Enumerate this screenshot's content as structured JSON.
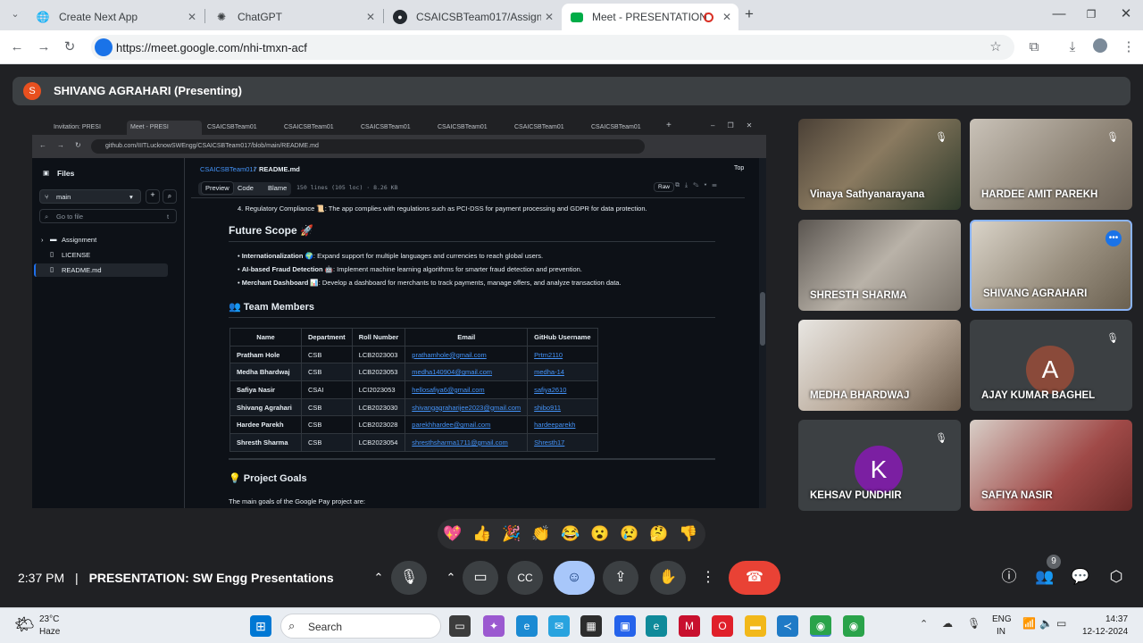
{
  "browser": {
    "tabs": [
      {
        "title": "Create Next App",
        "icon": "globe-icon"
      },
      {
        "title": "ChatGPT",
        "icon": "chatgpt-icon"
      },
      {
        "title": "CSAICSBTeam017/Assignment/",
        "icon": "github-icon"
      },
      {
        "title": "Meet - PRESENTATION: SW",
        "icon": "meet-icon",
        "active": true
      }
    ],
    "url": "https://meet.google.com/nhi-tmxn-acf"
  },
  "meet": {
    "presenter_initial": "S",
    "presenter": "SHIVANG AGRAHARI (Presenting)",
    "time": "2:37 PM",
    "separator": "|",
    "meeting_title": "PRESENTATION: SW Engg Presentations",
    "participant_count": "9",
    "participants": [
      {
        "name": "Vinaya Sathyanarayana",
        "muted": true
      },
      {
        "name": "HARDEE AMIT PAREKH",
        "muted": true
      },
      {
        "name": "SHRESTH SHARMA",
        "muted": false
      },
      {
        "name": "SHIVANG AGRAHARI",
        "muted": false,
        "speaking": true
      },
      {
        "name": "MEDHA BHARDWAJ",
        "muted": false
      },
      {
        "name": "AJAY KUMAR BAGHEL",
        "initial": "A",
        "muted": true
      },
      {
        "name": "KEHSAV PUNDHIR",
        "initial": "K",
        "muted": true
      },
      {
        "name": "SAFIYA NASIR",
        "muted": false
      }
    ],
    "reactions": [
      "💖",
      "👍",
      "🎉",
      "👏",
      "😂",
      "😮",
      "😢",
      "🤔",
      "👎"
    ]
  },
  "shared_screen": {
    "tabs": [
      "Invitation: PRESI",
      "Meet - PRESI",
      "CSAICSBTeam01",
      "CSAICSBTeam01",
      "CSAICSBTeam01",
      "CSAICSBTeam01",
      "CSAICSBTeam01",
      "CSAICSBTeam01"
    ],
    "url": "github.com/IIITLucknowSWEngg/CSAICSBTeam017/blob/main/README.md",
    "sidebar": {
      "title": "Files",
      "branch": "main",
      "search_placeholder": "Go to file",
      "search_shortcut": "t",
      "items": [
        "Assignment",
        "LICENSE",
        "README.md"
      ]
    },
    "breadcrumb_repo": "CSAICSBTeam017",
    "breadcrumb_sep": "/",
    "breadcrumb_file": "README.md",
    "top_link": "Top",
    "view_tabs": [
      "Preview",
      "Code",
      "Blame"
    ],
    "file_meta": "150 lines (105 loc) · 8.26 KB",
    "raw_label": "Raw",
    "compliance_line": "4. Regulatory Compliance 📜: The app complies with regulations such as PCI-DSS for payment processing and GDPR for data protection.",
    "future_scope_heading": "Future Scope 🚀",
    "future_items": [
      {
        "bold": "Internationalization 🌍",
        "text": ": Expand support for multiple languages and currencies to reach global users."
      },
      {
        "bold": "AI-based Fraud Detection 🤖",
        "text": ": Implement machine learning algorithms for smarter fraud detection and prevention."
      },
      {
        "bold": "Merchant Dashboard 📊",
        "text": ": Develop a dashboard for merchants to track payments, manage offers, and analyze transaction data."
      }
    ],
    "team_heading": "👥 Team Members",
    "team_columns": [
      "Name",
      "Department",
      "Roll Number",
      "Email",
      "GitHub Username"
    ],
    "team_rows": [
      [
        "Pratham Hole",
        "CSB",
        "LCB2023003",
        "prathamhole@gmail.com",
        "Prtm2110"
      ],
      [
        "Medha Bhardwaj",
        "CSB",
        "LCB2023053",
        "medha140904@gmail.com",
        "medha-14"
      ],
      [
        "Safiya Nasir",
        "CSAI",
        "LCI2023053",
        "hellosafiya6@gmail.com",
        "safiya2610"
      ],
      [
        "Shivang Agrahari",
        "CSB",
        "LCB2023030",
        "shivangagraharijee2023@gmail.com",
        "shibo911"
      ],
      [
        "Hardee Parekh",
        "CSB",
        "LCB2023028",
        "parekhhardee@gmail.com",
        "hardeeparekh"
      ],
      [
        "Shresth Sharma",
        "CSB",
        "LCB2023054",
        "shresthsharma1711@gmail.com",
        "Shresth17"
      ]
    ],
    "goals_heading": "💡 Project Goals",
    "goals_text": "The main goals of the Google Pay project are:"
  },
  "taskbar": {
    "temp": "23°C",
    "weather": "Haze",
    "search": "Search",
    "lang1": "ENG",
    "lang2": "IN",
    "clock": "14:37",
    "date": "12-12-2024"
  },
  "colors": {
    "meet_bg": "#202124",
    "leave": "#e94235",
    "accent": "#a8c7fa",
    "gh_bg": "#0d1117",
    "link": "#4493f8"
  }
}
